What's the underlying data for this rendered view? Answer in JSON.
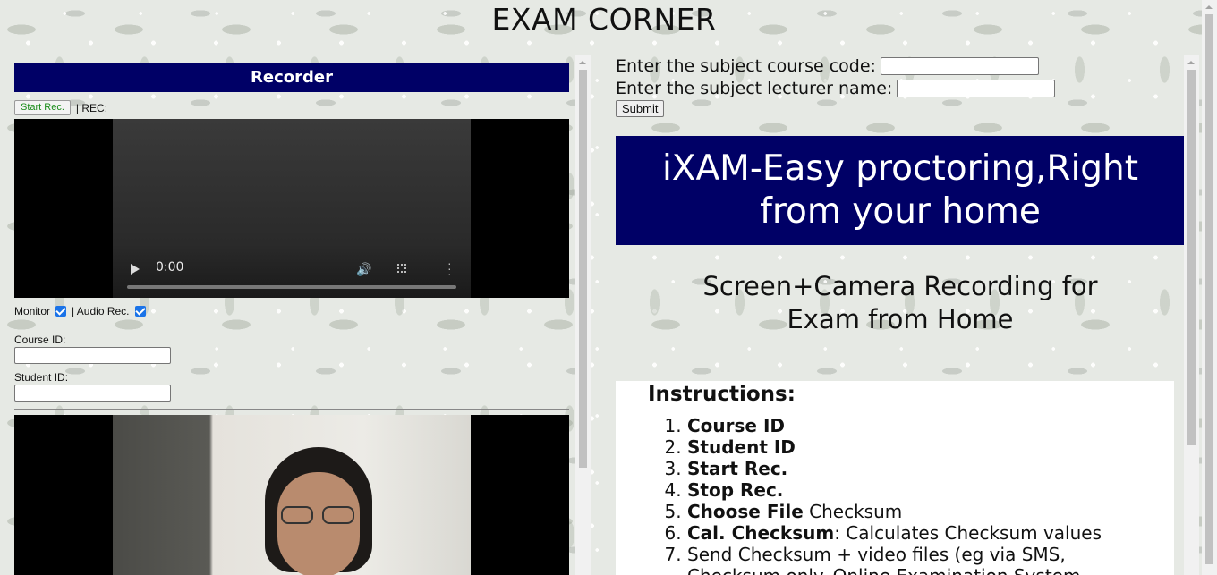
{
  "page": {
    "title": "EXAM CORNER"
  },
  "recorder": {
    "header": "Recorder",
    "start_button": "Start Rec.",
    "rec_label": "| REC:",
    "video1": {
      "time": "0:00"
    },
    "monitor_label": "Monitor",
    "monitor_checked": true,
    "audio_label": "| Audio Rec.",
    "audio_checked": true,
    "course_id_label": "Course ID:",
    "course_id_value": "",
    "student_id_label": "Student ID:",
    "student_id_value": ""
  },
  "subject_form": {
    "course_code_label": "Enter the subject course code:",
    "course_code_value": "",
    "lecturer_label": "Enter the subject lecturer name:",
    "lecturer_value": "",
    "submit_label": "Submit"
  },
  "banner": {
    "text": "iXAM-Easy proctoring,Right from your home",
    "bg_color": "#000066"
  },
  "subtitle": "Screen+Camera Recording for Exam from Home",
  "instructions": {
    "title": "Instructions:",
    "items": [
      {
        "bold": "Course ID",
        "rest": ""
      },
      {
        "bold": "Student ID",
        "rest": ""
      },
      {
        "bold": "Start Rec.",
        "rest": ""
      },
      {
        "bold": "Stop Rec.",
        "rest": ""
      },
      {
        "bold": "Choose File",
        "rest": " Checksum"
      },
      {
        "bold": "Cal. Checksum",
        "rest": ": Calculates Checksum values"
      },
      {
        "bold": "",
        "rest": "Send Checksum + video files (eg via SMS, Checksum only. Online Examination System..."
      }
    ]
  }
}
